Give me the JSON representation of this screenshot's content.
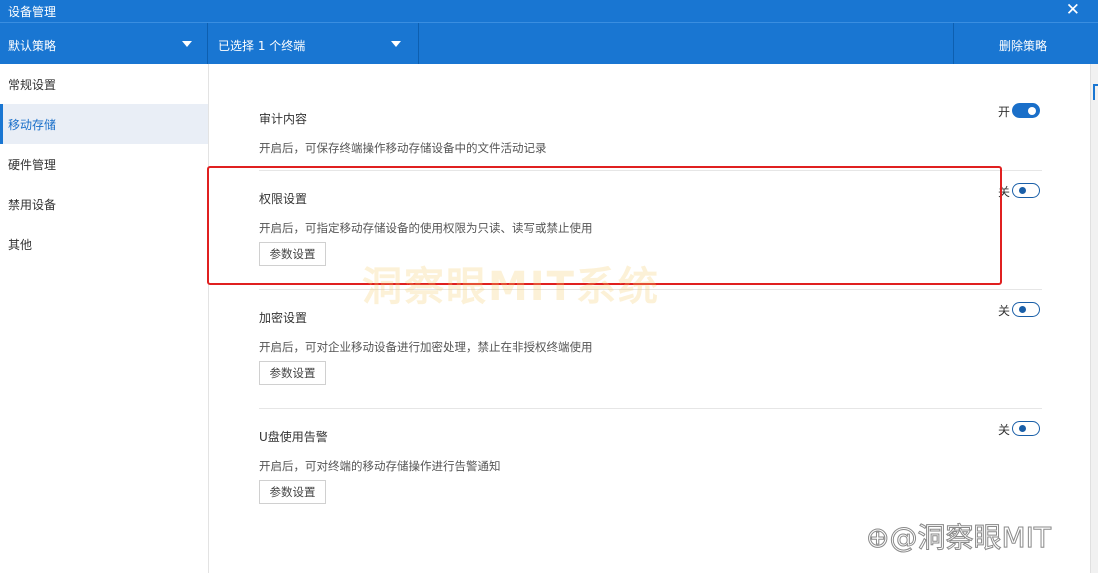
{
  "window": {
    "title": "设备管理"
  },
  "toolbar": {
    "policy_label": "默认策略",
    "terminal_label": "已选择 1 个终端",
    "delete_label": "删除策略"
  },
  "sidebar": {
    "items": [
      {
        "label": "常规设置"
      },
      {
        "label": "移动存储",
        "active": true
      },
      {
        "label": "硬件管理"
      },
      {
        "label": "禁用设备"
      },
      {
        "label": "其他"
      }
    ]
  },
  "settings": [
    {
      "title": "审计内容",
      "desc": "开启后，可保存终端操作移动存储设备中的文件活动记录",
      "toggle_label": "开",
      "enabled": true
    },
    {
      "title": "权限设置",
      "desc": "开启后，可指定移动存储设备的使用权限为只读、读写或禁止使用",
      "toggle_label": "关",
      "enabled": false,
      "param_button": "参数设置"
    },
    {
      "title": "加密设置",
      "desc": "开启后，可对企业移动设备进行加密处理，禁止在非授权终端使用",
      "toggle_label": "关",
      "enabled": false,
      "param_button": "参数设置"
    },
    {
      "title": "U盘使用告警",
      "desc": "开启后，可对终端的移动存储操作进行告警通知",
      "toggle_label": "关",
      "enabled": false,
      "param_button": "参数设置"
    }
  ],
  "watermarks": {
    "center": "洞察眼MIT系统",
    "corner": "洞察眼MIT"
  },
  "colors": {
    "brand": "#1976d2",
    "highlight": "#e02020",
    "toggle_on": "#1a6fc9"
  }
}
